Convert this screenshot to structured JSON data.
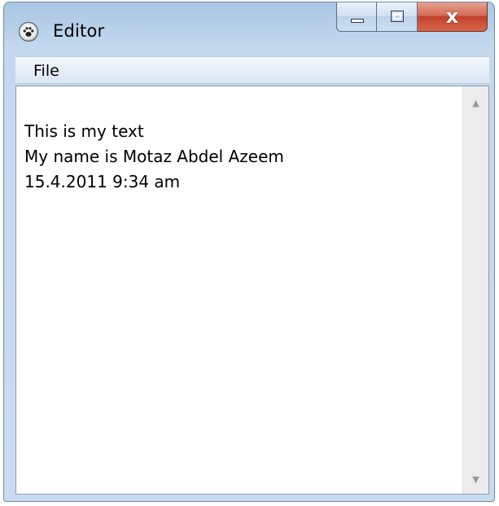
{
  "window": {
    "title": "Editor",
    "icon": "paw-icon",
    "close_glyph": "x"
  },
  "menubar": {
    "items": [
      {
        "label": "File"
      }
    ]
  },
  "editor": {
    "lines": [
      "This is my text",
      "My name is Motaz Abdel Azeem",
      "15.4.2011 9:34 am"
    ]
  },
  "scrollbar": {
    "up_arrow": "▲",
    "down_arrow": "▼"
  },
  "colors": {
    "close_button": "#c94a32",
    "frame": "#c4d9ee"
  }
}
